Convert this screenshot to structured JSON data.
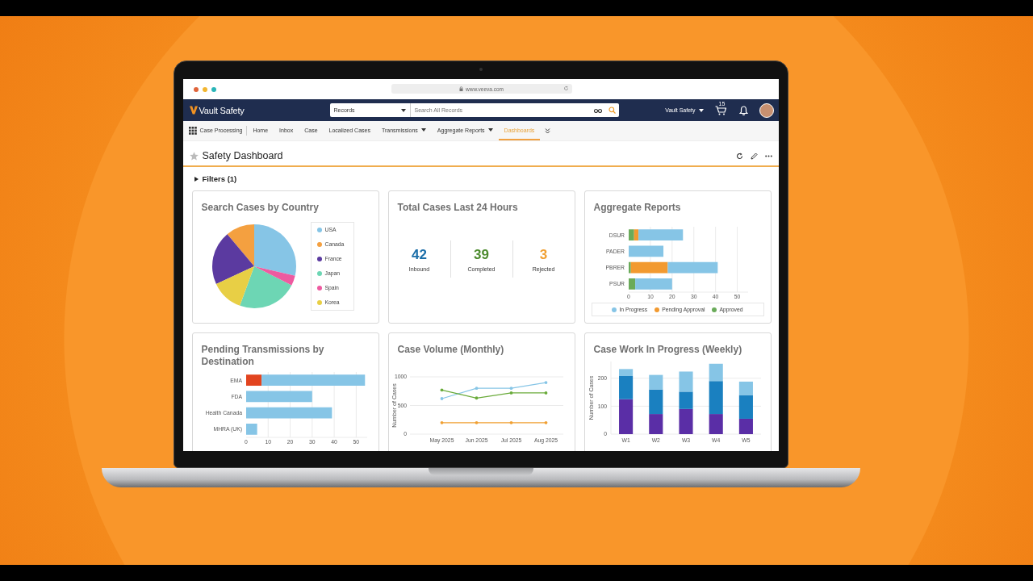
{
  "browser": {
    "url": "www.veeva.com"
  },
  "header": {
    "app_name": "Vault Safety",
    "search_scope": "Records",
    "search_placeholder": "Search All Records",
    "vault_menu": "Vault Safety",
    "cart_badge": "15"
  },
  "nav": {
    "app_label": "Case Processing",
    "tabs": [
      {
        "label": "Home",
        "selected": false,
        "dropdown": false
      },
      {
        "label": "Inbox",
        "selected": false,
        "dropdown": false
      },
      {
        "label": "Case",
        "selected": false,
        "dropdown": false
      },
      {
        "label": "Localized Cases",
        "selected": false,
        "dropdown": false
      },
      {
        "label": "Transmissions",
        "selected": false,
        "dropdown": true
      },
      {
        "label": "Aggregate Reports",
        "selected": false,
        "dropdown": true
      },
      {
        "label": "Dashboards",
        "selected": true,
        "dropdown": false
      }
    ]
  },
  "page": {
    "title": "Safety Dashboard"
  },
  "filters": {
    "label": "Filters (1)",
    "expanded": false
  },
  "cards": [
    {
      "kind": "pie",
      "title": "Search Cases by Country",
      "legend": [
        {
          "label": "USA",
          "color": "#86c5e6"
        },
        {
          "label": "Canada",
          "color": "#f4a040"
        },
        {
          "label": "France",
          "color": "#5b3aa0"
        },
        {
          "label": "Japan",
          "color": "#6dd6b4"
        },
        {
          "label": "Spain",
          "color": "#ee5aa0"
        },
        {
          "label": "Korea",
          "color": "#e8cf45"
        }
      ]
    },
    {
      "kind": "kpi",
      "title": "Total Cases Last 24 Hours",
      "stats": [
        {
          "value": "42",
          "label": "Inbound",
          "color": "#1b6ea8"
        },
        {
          "value": "39",
          "label": "Completed",
          "color": "#4d8b2e"
        },
        {
          "value": "3",
          "label": "Rejected",
          "color": "#f0a033"
        }
      ]
    },
    {
      "kind": "chart",
      "title": "Aggregate Reports",
      "chart_data": {
        "type": "bar",
        "orientation": "horizontal",
        "stacked": true,
        "categories": [
          "DSUR",
          "PADER",
          "PBRER",
          "PSUR"
        ],
        "grid": true,
        "xlim": [
          0,
          55
        ],
        "xticks": [
          0,
          10,
          20,
          30,
          40,
          50
        ],
        "series": [
          {
            "name": "In Progress",
            "color": "#86c5e6",
            "values": [
              20.5,
              16,
              23,
              17
            ]
          },
          {
            "name": "Pending Approval",
            "color": "#f29a30",
            "values": [
              2,
              0,
              17,
              0
            ]
          },
          {
            "name": "Approved",
            "color": "#6aab5a",
            "values": [
              2.5,
              0,
              1,
              3
            ]
          }
        ]
      }
    },
    {
      "kind": "chart",
      "title": "Pending Transmissions by Destination",
      "chart_data": {
        "type": "bar",
        "orientation": "horizontal",
        "stacked": true,
        "categories": [
          "EMA",
          "FDA",
          "Health Canada",
          "MHRA (UK)"
        ],
        "grid": true,
        "xlim": [
          0,
          55
        ],
        "xticks": [
          0,
          10,
          20,
          30,
          40,
          50
        ],
        "series": [
          {
            "color": "#86c5e6",
            "values": [
              47,
              30,
              39,
              5
            ]
          },
          {
            "color": "#e2441f",
            "values": [
              7,
              0,
              0,
              0
            ]
          }
        ]
      }
    },
    {
      "kind": "chart",
      "title": "Case Volume (Monthly)",
      "chart_data": {
        "type": "line",
        "ylabel": "Number of Cases",
        "categories": [
          "May 2025",
          "Jun 2025",
          "Jul 2025",
          "Aug 2025"
        ],
        "grid": true,
        "ylim": [
          0,
          1000
        ],
        "yticks": [
          0,
          500,
          1000
        ],
        "series": [
          {
            "color": "#86c5e6",
            "values": [
              620,
              800,
              800,
              900
            ]
          },
          {
            "color": "#6aab3a",
            "values": [
              770,
              630,
              720,
              720
            ]
          },
          {
            "color": "#f0a033",
            "values": [
              200,
              200,
              200,
              200
            ]
          }
        ]
      }
    },
    {
      "kind": "chart",
      "title": "Case Work In Progress (Weekly)",
      "chart_data": {
        "type": "bar",
        "orientation": "vertical",
        "stacked": true,
        "ylabel": "Number of Cases",
        "categories": [
          "W1",
          "W2",
          "W3",
          "W4",
          "W5"
        ],
        "grid": true,
        "ylim": [
          0,
          260
        ],
        "yticks": [
          0,
          100,
          200
        ],
        "series": [
          {
            "color": "#86c5e6",
            "values": [
              25,
              52,
              72,
              62,
              48
            ]
          },
          {
            "color": "#1a80c0",
            "values": [
              83,
              88,
              62,
              118,
              85
            ]
          },
          {
            "color": "#5a2ea6",
            "values": [
              125,
              72,
              90,
              72,
              55
            ]
          }
        ]
      }
    }
  ]
}
